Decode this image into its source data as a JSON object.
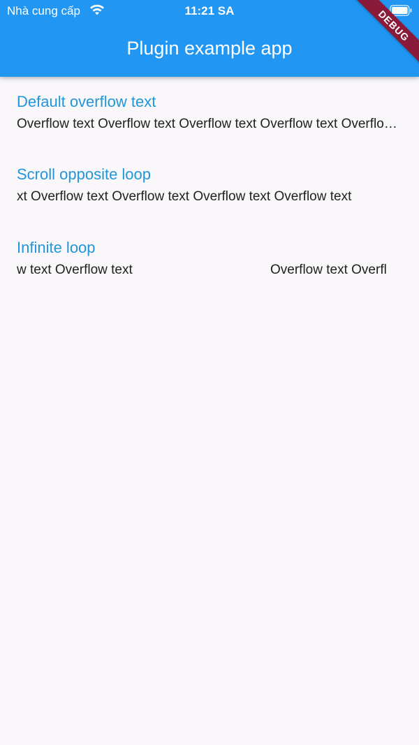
{
  "status_bar": {
    "carrier": "Nhà cung cấp",
    "time": "11:21 SA",
    "wifi_icon": "wifi-icon",
    "battery_icon": "battery-icon"
  },
  "app_bar": {
    "title": "Plugin example app",
    "color": "#2196f3"
  },
  "debug_banner": {
    "label": "DEBUG",
    "color": "#8a1a3a"
  },
  "sections": [
    {
      "title": "Default overflow text",
      "text": "Overflow text Overflow text Overflow text Overflow text Overflow text"
    },
    {
      "title": "Scroll opposite loop",
      "text": "xt Overflow text Overflow text Overflow text Overflow text"
    },
    {
      "title": "Infinite loop",
      "text_a": "w text Overflow text",
      "text_b": "Overflow text Overfl"
    }
  ],
  "colors": {
    "accent": "#2196d8",
    "body_text": "#212121",
    "background": "#f9f7fa"
  }
}
